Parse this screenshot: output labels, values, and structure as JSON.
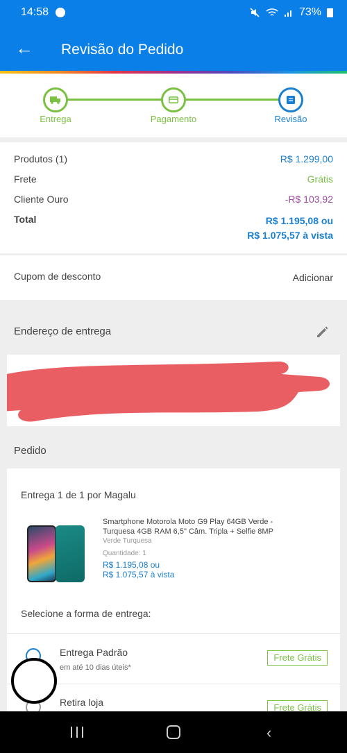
{
  "status_bar": {
    "time": "14:58",
    "battery": "73%"
  },
  "header": {
    "title": "Revisão do Pedido"
  },
  "stepper": {
    "steps": [
      {
        "label": "Entrega",
        "color": "#7ac143"
      },
      {
        "label": "Pagamento",
        "color": "#7ac143"
      },
      {
        "label": "Revisão",
        "color": "#1a7fd1"
      }
    ]
  },
  "summary": {
    "products_label": "Produtos (1)",
    "products_value": "R$ 1.299,00",
    "shipping_label": "Frete",
    "shipping_value": "Grátis",
    "gold_label": "Cliente Ouro",
    "gold_value": "-R$ 103,92",
    "total_label": "Total",
    "total_value_line1": "R$ 1.195,08 ou",
    "total_value_line2": "R$ 1.075,57 à vista"
  },
  "coupon": {
    "label": "Cupom de desconto",
    "action": "Adicionar"
  },
  "address": {
    "title": "Endereço de entrega"
  },
  "order": {
    "section_title": "Pedido",
    "delivery_header": "Entrega 1 de 1 por Magalu",
    "product": {
      "name": "Smartphone Motorola Moto G9 Play 64GB Verde - Turquesa 4GB RAM 6,5\" Câm. Tripla + Selfie 8MP",
      "variant": "Verde Turquesa",
      "quantity": "Quantidade:  1",
      "price_line1": "R$ 1.195,08 ou",
      "price_line2": "R$ 1.075,57 à vista"
    },
    "select_label": "Selecione a forma de entrega:",
    "options": [
      {
        "title": "Entrega Padrão",
        "subtitle": "em até 10 dias úteis*",
        "badge": "Frete Grátis"
      },
      {
        "title": "Retira loja",
        "badge": "Frete Grátis"
      }
    ]
  },
  "colors": {
    "primary": "#0a7fe8",
    "green": "#7ac143",
    "blue_text": "#1a7fd1",
    "purple": "#9c4c9e"
  }
}
